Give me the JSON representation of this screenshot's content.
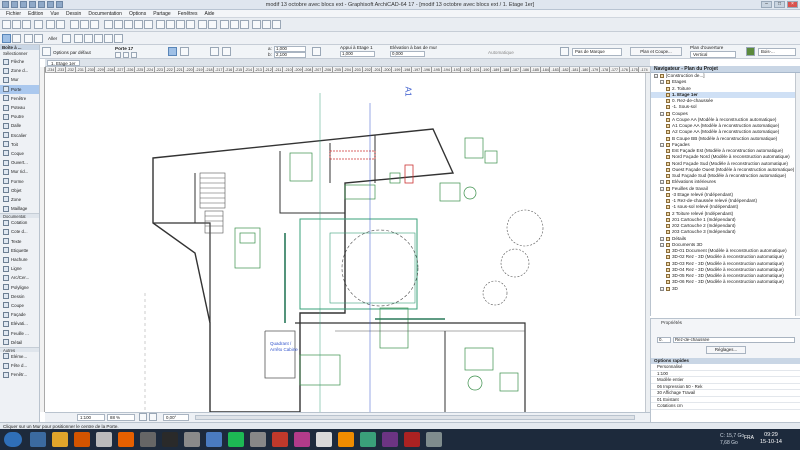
{
  "window": {
    "title": "modif 13 octobre avec blocs ext - Graphisoft ArchiCAD-64 17 - [modif 13 octobre avec blocs ext / 1. Etage 1er]"
  },
  "menu": [
    "Fichier",
    "Edition",
    "Vue",
    "Dessin",
    "Documentation",
    "Options",
    "Partage",
    "Fenêtres",
    "Aide"
  ],
  "toolbar": {
    "door_name": "Porte 17",
    "default_options": "Options par défaut",
    "width_value": "1,000",
    "height_value": "2,100",
    "anchor_label": "Appui à Etage 1",
    "anchor_value": "1,000",
    "sill_label": "Elévation à bas de mur",
    "sill_value": "0,000",
    "auto_label": "Automatique",
    "placement_label": "Pas de Marque",
    "plan_coupe_button": "Plan et Coupe...",
    "opening_label": "Plan d'ouverture",
    "opening_value": "Vertical",
    "material_value": "Bois-..."
  },
  "toolbox": {
    "header": "Boîte à ...",
    "select_label": "Sélectionner",
    "sections": {
      "design": "Dessin",
      "document": "Documentat",
      "more": "Autres"
    },
    "design_tools": [
      "Flèche",
      "Zone d...",
      "Mur",
      "Porte",
      "Fenêtre",
      "Poteau",
      "Poutre",
      "Dalle",
      "Escalier",
      "Toit",
      "Coque",
      "Ouvert...",
      "Mur rid...",
      "Forme",
      "Objet",
      "Zone",
      "Maillage"
    ],
    "document_tools": [
      "Cotation",
      "Cote d...",
      "Texte",
      "Etiquette",
      "Hachure",
      "Ligne",
      "Arc/Cer...",
      "Polyligne",
      "Dessin",
      "Coupe",
      "Façade",
      "Elévati...",
      "Feuille ...",
      "Détail"
    ],
    "more_tools": [
      "Eléme...",
      "Fête d...",
      "Fenêtr..."
    ]
  },
  "view_tab": "1. Etage 1er",
  "ruler_ticks": [
    "-234",
    "-233",
    "-232",
    "-231",
    "-230",
    "-229",
    "-228",
    "-227",
    "-226",
    "-225",
    "-224",
    "-223",
    "-222",
    "-221",
    "-220",
    "-219",
    "-218",
    "-217",
    "-216",
    "-215",
    "-214",
    "-213",
    "-212",
    "-211",
    "-210",
    "-209",
    "-208",
    "-207",
    "-206",
    "-205",
    "-204",
    "-203",
    "-202",
    "-201",
    "-200",
    "-199",
    "-198",
    "-197",
    "-196",
    "-195",
    "-194",
    "-193",
    "-192",
    "-191",
    "-190",
    "-189",
    "-188",
    "-187",
    "-186",
    "-185",
    "-184",
    "-183",
    "-182",
    "-181",
    "-180",
    "-179",
    "-178",
    "-177",
    "-176",
    "-175",
    "-174"
  ],
  "drawing": {
    "section_marker": "A1",
    "room_label_line1": "Quadrant /",
    "room_label_line2": "Arrêto Cabine"
  },
  "canvas_status": {
    "scale": "1:100",
    "zoom": "88 %",
    "angle": "0,00°"
  },
  "navigator": {
    "header": "Navigateur - Plan du Projet",
    "items": [
      {
        "label": "[Construction de...]",
        "level": 0,
        "type": "root"
      },
      {
        "label": "Etages",
        "level": 1,
        "type": "folder"
      },
      {
        "label": "2. Toiture",
        "level": 2,
        "type": "item"
      },
      {
        "label": "1. Etage 1er",
        "level": 2,
        "type": "item",
        "selected": true
      },
      {
        "label": "0. Rez-de-chaussée",
        "level": 2,
        "type": "item"
      },
      {
        "label": "-1. Sous-sol",
        "level": 2,
        "type": "item"
      },
      {
        "label": "Coupes",
        "level": 1,
        "type": "folder"
      },
      {
        "label": "A Coupe AA (Modèle à reconstruction automatique)",
        "level": 2,
        "type": "item"
      },
      {
        "label": "A1 Coupe AA (Modèle à reconstruction automatique)",
        "level": 2,
        "type": "item"
      },
      {
        "label": "A2 Coupe AA (Modèle à reconstruction automatique)",
        "level": 2,
        "type": "item"
      },
      {
        "label": "B Coupe BB (Modèle à reconstruction automatique)",
        "level": 2,
        "type": "item"
      },
      {
        "label": "Façades",
        "level": 1,
        "type": "folder"
      },
      {
        "label": "Est Façade Est (Modèle à reconstruction automatique)",
        "level": 2,
        "type": "item"
      },
      {
        "label": "Nord Façade Nord (Modèle à reconstruction automatique)",
        "level": 2,
        "type": "item"
      },
      {
        "label": "Nord Façade Sud (Modèle à reconstruction automatique)",
        "level": 2,
        "type": "item"
      },
      {
        "label": "Ouest Façade Ouest (Modèle à reconstruction automatique)",
        "level": 2,
        "type": "item"
      },
      {
        "label": "Sud Façade Sud (Modèle à reconstruction automatique)",
        "level": 2,
        "type": "item"
      },
      {
        "label": "Elévations intérieures",
        "level": 1,
        "type": "folder"
      },
      {
        "label": "Feuilles de travail",
        "level": 1,
        "type": "folder"
      },
      {
        "label": "-3 Etage relevé (Indépendant)",
        "level": 2,
        "type": "item"
      },
      {
        "label": "-1 Rez-de-chaussée relevé (Indépendant)",
        "level": 2,
        "type": "item"
      },
      {
        "label": "-1 sous-sol relevé (Indépendant)",
        "level": 2,
        "type": "item"
      },
      {
        "label": "2 Toiture relevé (Indépendant)",
        "level": 2,
        "type": "item"
      },
      {
        "label": "z01 Cartouche 1 (Indépendant)",
        "level": 2,
        "type": "item"
      },
      {
        "label": "z02 Cartouche 2 (Indépendant)",
        "level": 2,
        "type": "item"
      },
      {
        "label": "z03 Cartouche 3 (Indépendant)",
        "level": 2,
        "type": "item"
      },
      {
        "label": "Détails",
        "level": 1,
        "type": "folder"
      },
      {
        "label": "Documents 3D",
        "level": 1,
        "type": "folder"
      },
      {
        "label": "3D-01 Document (Modèle à reconstruction automatique)",
        "level": 2,
        "type": "item"
      },
      {
        "label": "3D-02 Rez - 3D (Modèle à reconstruction automatique)",
        "level": 2,
        "type": "item"
      },
      {
        "label": "3D-03 Rez - 3D (Modèle à reconstruction automatique)",
        "level": 2,
        "type": "item"
      },
      {
        "label": "3D-04 Rez - 3D (Modèle à reconstruction automatique)",
        "level": 2,
        "type": "item"
      },
      {
        "label": "3D-05 Rez - 3D (Modèle à reconstruction automatique)",
        "level": 2,
        "type": "item"
      },
      {
        "label": "3D-06 Rez - 3D (Modèle à reconstruction automatique)",
        "level": 2,
        "type": "item"
      },
      {
        "label": "3D",
        "level": 1,
        "type": "folder"
      }
    ]
  },
  "properties": {
    "header": "Propriétés",
    "story_num": "0.",
    "story_name": "Rez-de-chaussée",
    "settings_button": "Réglages..."
  },
  "quick_options": {
    "header": "Options rapides",
    "rows": [
      "Personnalisé",
      "1:100",
      "Modèle entier",
      "06 Impression 50 - Rek",
      "30 Affichage Travail",
      "01 Existant",
      "Cotations cm"
    ]
  },
  "status_line": "Cliquer sur un Mur pour positionner le centre de la Porte.",
  "taskbar": {
    "time": "09:29",
    "date": "15-10-14",
    "lang": "FRA",
    "drive_c": "C: 15,7 Go",
    "drive_d": "7,68 Go"
  }
}
